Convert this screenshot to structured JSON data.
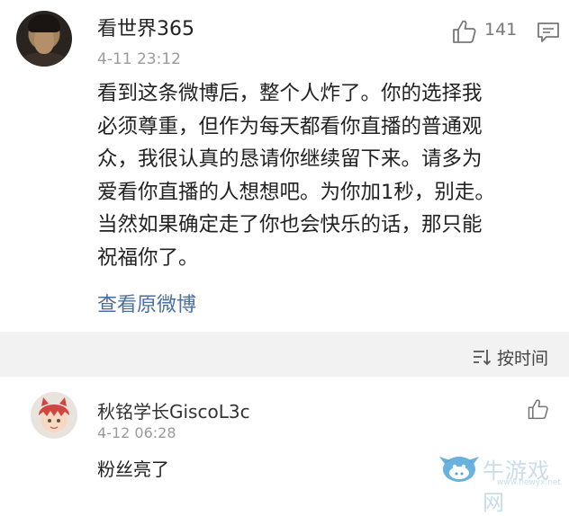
{
  "post": {
    "username": "看世界365",
    "timestamp": "4-11 23:12",
    "like_count": "141",
    "body_lines": [
      "看到这条微博后，整个人炸了。你的选择我",
      "必须尊重，但作为每天都看你直播的普通观",
      "众，我很认真的恳请你继续留下来。请多为",
      "爱看你直播的人想想吧。为你加1秒，别走。",
      "当然如果确定走了你也会快乐的话，那只能",
      "祝福你了。"
    ],
    "view_original_label": "查看原微博"
  },
  "comments_header": {
    "sort_label": "按时间"
  },
  "comment": {
    "username": "秋铭学长GiscoL3c",
    "timestamp": "4-12 06:28",
    "text": "粉丝亮了"
  },
  "watermark": {
    "text": "牛游戏网",
    "url": "www.newyx.net"
  },
  "icons": [
    "thumbs-up-icon",
    "comment-icon",
    "sort-icon",
    "thumbs-up-icon",
    "watermark-logo"
  ]
}
